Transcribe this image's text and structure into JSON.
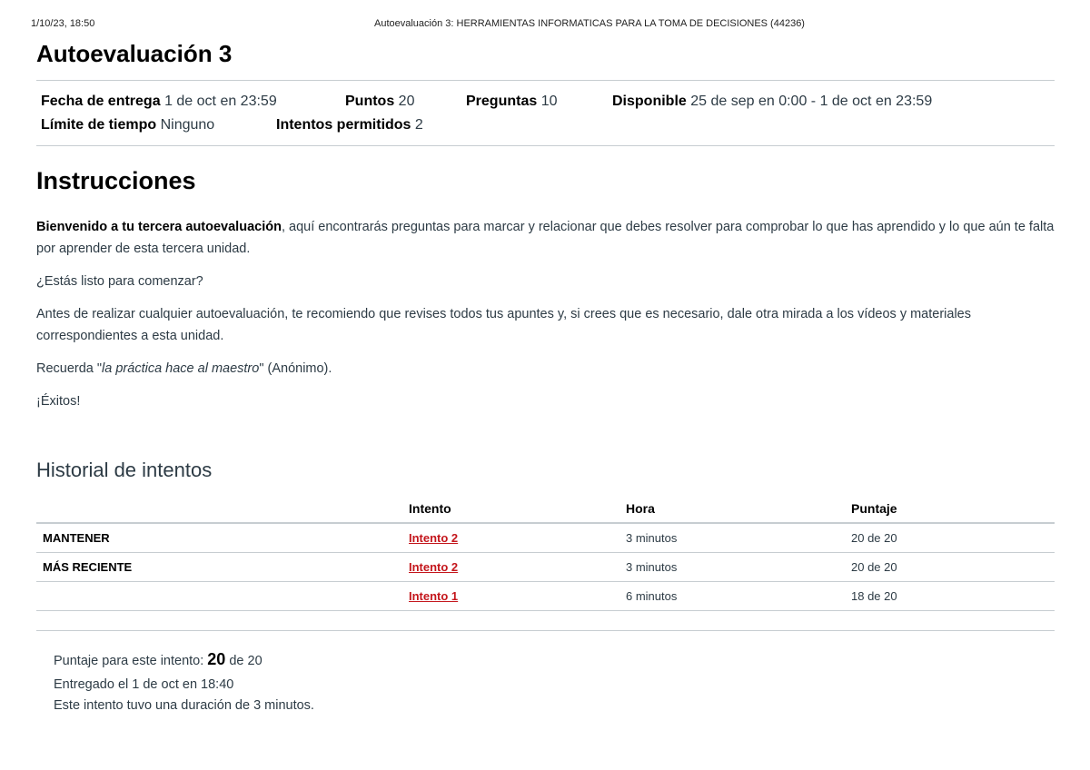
{
  "print_header": {
    "date": "1/10/23, 18:50",
    "title": "Autoevaluación 3: HERRAMIENTAS INFORMATICAS PARA LA TOMA DE DECISIONES (44236)"
  },
  "quiz": {
    "title": "Autoevaluación 3",
    "details": {
      "due_label": "Fecha de entrega",
      "due_value": "1 de oct en 23:59",
      "points_label": "Puntos",
      "points_value": "20",
      "questions_label": "Preguntas",
      "questions_value": "10",
      "available_label": "Disponible",
      "available_value": "25 de sep en 0:00 - 1 de oct en 23:59",
      "time_limit_label": "Límite de tiempo",
      "time_limit_value": "Ninguno",
      "attempts_label": "Intentos permitidos",
      "attempts_value": "2"
    }
  },
  "instructions": {
    "heading": "Instrucciones",
    "p1_bold": "Bienvenido a tu tercera autoevaluación",
    "p1_rest": ", aquí encontrarás preguntas para marcar y relacionar que debes resolver para comprobar lo que has aprendido y lo que aún te falta por aprender de esta tercera unidad.",
    "p2": "¿Estás listo para comenzar?",
    "p3": "Antes de realizar cualquier autoevaluación, te recomiendo que revises todos tus apuntes y, si crees que es necesario, dale otra mirada a los vídeos y materiales correspondientes a esta unidad.",
    "p4_before": "Recuerda \"",
    "p4_italic": "la práctica hace al maestro",
    "p4_after": "\" (Anónimo).",
    "p5": "¡Éxitos!"
  },
  "history": {
    "heading": "Historial de intentos",
    "columns": [
      "",
      "Intento",
      "Hora",
      "Puntaje"
    ],
    "rows": [
      {
        "label": "MANTENER",
        "attempt": "Intento 2",
        "time": "3 minutos",
        "score": "20 de 20"
      },
      {
        "label": "MÁS RECIENTE",
        "attempt": "Intento 2",
        "time": "3 minutos",
        "score": "20 de 20"
      },
      {
        "label": "",
        "attempt": "Intento 1",
        "time": "6 minutos",
        "score": "18 de 20"
      }
    ]
  },
  "summary": {
    "score_prefix": "Puntaje para este intento:",
    "score_value": "20",
    "score_suffix": "de 20",
    "submitted": "Entregado el 1 de oct en 18:40",
    "duration": "Este intento tuvo una duración de 3 minutos."
  },
  "colors": {
    "link": "#c4161c",
    "text": "#2d3b45",
    "rule": "#c7cdd1"
  }
}
